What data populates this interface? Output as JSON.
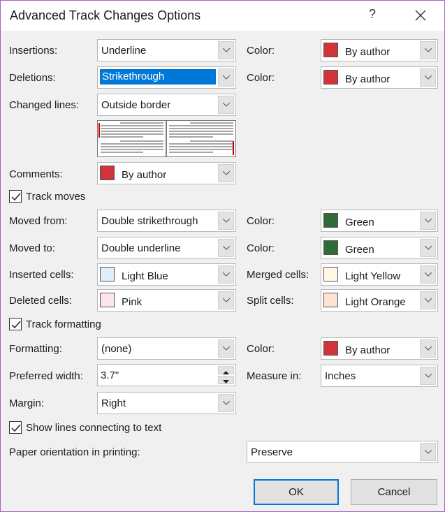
{
  "window": {
    "title": "Advanced Track Changes Options",
    "help_label": "?",
    "close_icon": "close-icon"
  },
  "colors": {
    "by_author": "#d13438",
    "green": "#2e6b39",
    "light_blue": "#deeefa",
    "pink": "#fce4f0",
    "light_yellow": "#fff8e4",
    "light_orange": "#fde3d3",
    "highlight": "#0078d7",
    "border_accent": "#a35fcf"
  },
  "insertions": {
    "label": "Insertions:",
    "value": "Underline",
    "color_label": "Color:",
    "color_value": "By author"
  },
  "deletions": {
    "label": "Deletions:",
    "value": "Strikethrough",
    "color_label": "Color:",
    "color_value": "By author"
  },
  "changed_lines": {
    "label": "Changed lines:",
    "value": "Outside border"
  },
  "comments": {
    "label": "Comments:",
    "value": "By author"
  },
  "track_moves": {
    "label": "Track moves",
    "checked": true
  },
  "moved_from": {
    "label": "Moved from:",
    "value": "Double strikethrough",
    "color_label": "Color:",
    "color_value": "Green"
  },
  "moved_to": {
    "label": "Moved to:",
    "value": "Double underline",
    "color_label": "Color:",
    "color_value": "Green"
  },
  "inserted_cells": {
    "label": "Inserted cells:",
    "value": "Light Blue"
  },
  "merged_cells": {
    "label": "Merged cells:",
    "value": "Light Yellow"
  },
  "deleted_cells": {
    "label": "Deleted cells:",
    "value": "Pink"
  },
  "split_cells": {
    "label": "Split cells:",
    "value": "Light Orange"
  },
  "track_formatting": {
    "label": "Track formatting",
    "checked": true
  },
  "formatting": {
    "label": "Formatting:",
    "value": "(none)",
    "color_label": "Color:",
    "color_value": "By author"
  },
  "preferred_width": {
    "label": "Preferred width:",
    "value": "3.7\""
  },
  "measure_in": {
    "label": "Measure in:",
    "value": "Inches"
  },
  "margin": {
    "label": "Margin:",
    "value": "Right"
  },
  "show_lines": {
    "label": "Show lines connecting to text",
    "checked": true
  },
  "paper_orientation": {
    "label": "Paper orientation in printing:",
    "value": "Preserve"
  },
  "buttons": {
    "ok": "OK",
    "cancel": "Cancel"
  }
}
